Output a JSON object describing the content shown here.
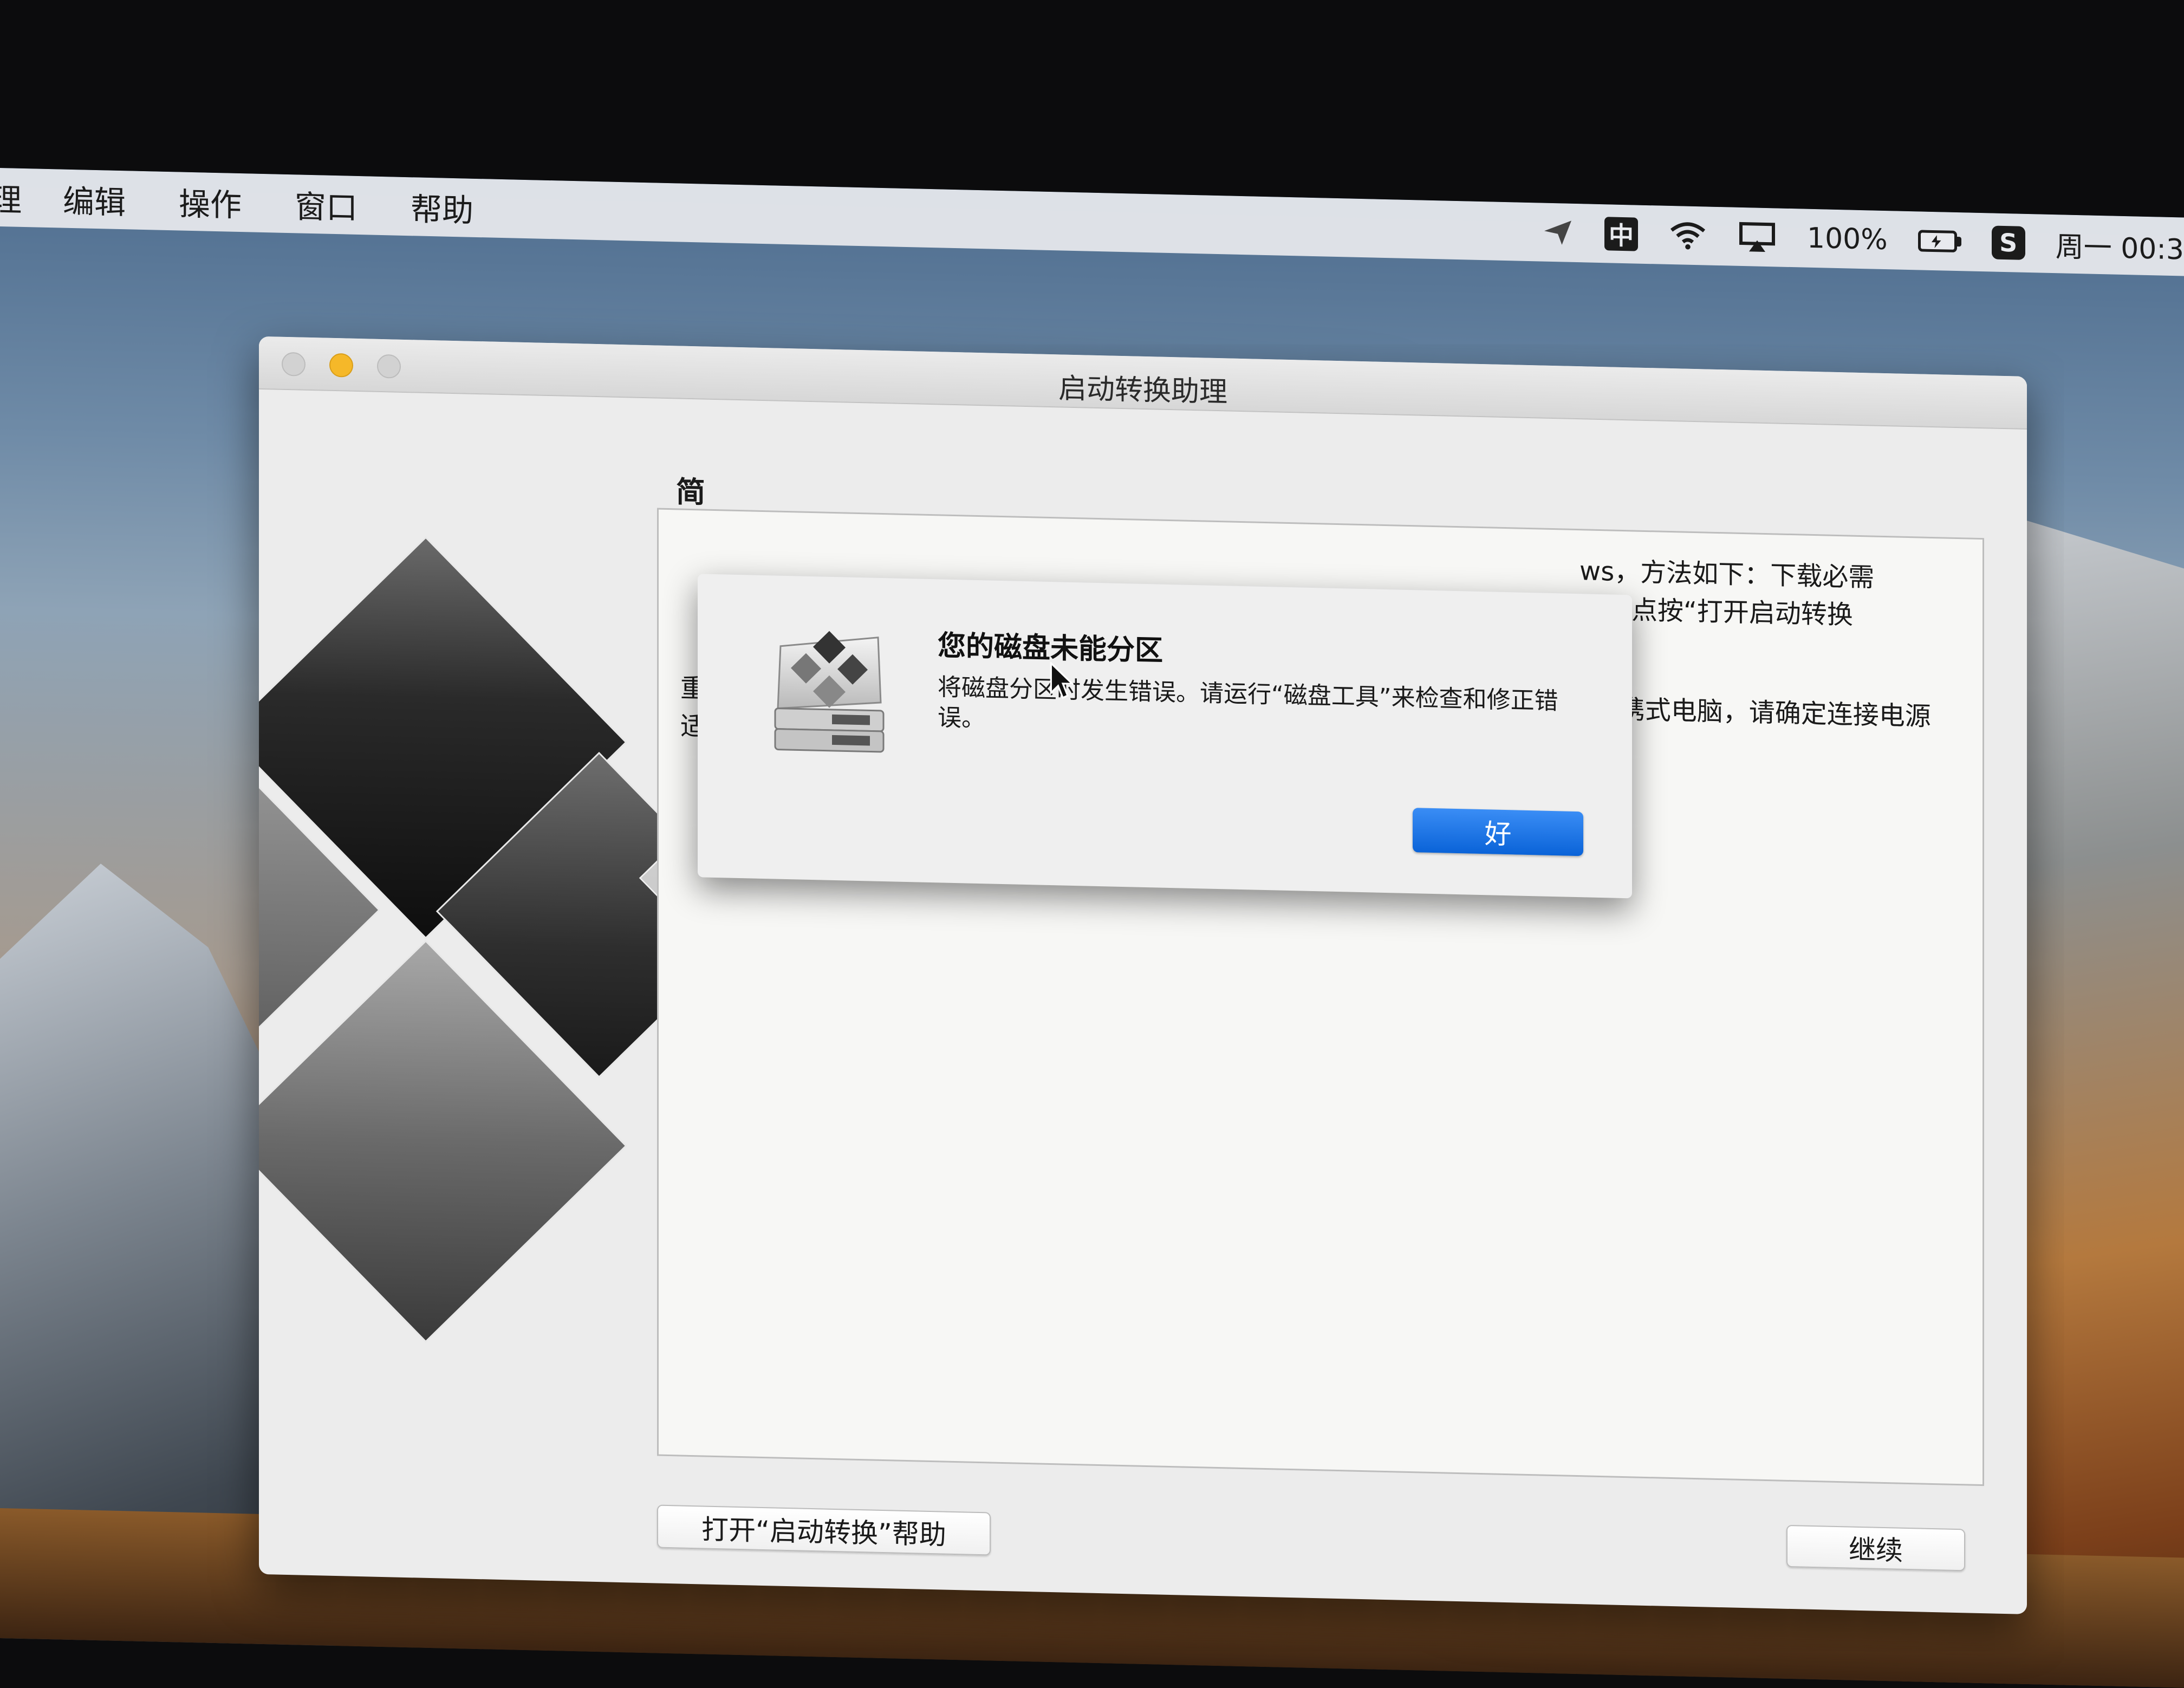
{
  "menubar": {
    "partial_left": "理",
    "items": [
      "编辑",
      "操作",
      "窗口",
      "帮助"
    ],
    "status": {
      "ime": "中",
      "battery_text": "100%",
      "sogou": "S",
      "clock": "周一 00:3"
    }
  },
  "window": {
    "title": "启动转换助理",
    "intro_heading": "简",
    "content": {
      "line1_right": "ws，方法如下：下载必需",
      "line2_right": "。请点按“打开启动转换",
      "line3_right": "。",
      "para2": "重要事项：请在进行磁盘分区或安装 Windows 之前备份磁盘。如果您使用的是便携式电脑，请确定连接电源适配器。"
    },
    "help_button": "打开“启动转换”帮助",
    "continue_button": "继续"
  },
  "alert": {
    "title": "您的磁盘未能分区",
    "message": "将磁盘分区时发生错误。请运行“磁盘工具”来检查和修正错误。",
    "ok_button": "好"
  },
  "colors": {
    "accent": "#0a63d8",
    "minimize": "#f5b829"
  },
  "icons": [
    "send-icon",
    "ime-icon",
    "wifi-icon",
    "airplay-icon",
    "battery-icon",
    "sogou-icon",
    "boot-camp-disk-icon",
    "cursor-icon"
  ]
}
